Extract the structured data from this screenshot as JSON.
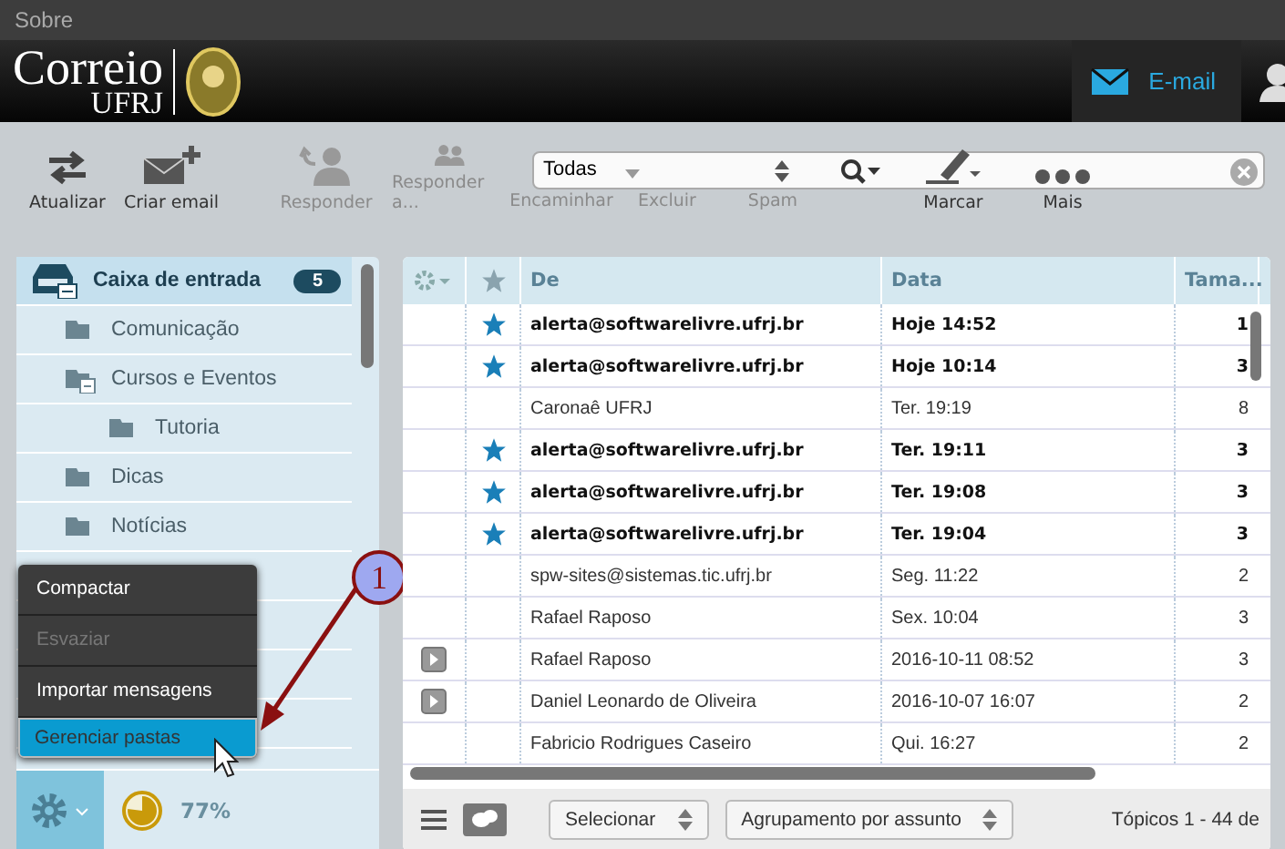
{
  "top_bar": {
    "link": "Sobre"
  },
  "header": {
    "logo_title": "Correio",
    "logo_subtitle": "UFRJ",
    "nav": [
      {
        "label": "E-mail",
        "selected": true,
        "kind": "mail"
      },
      {
        "selected": false,
        "kind": "person"
      }
    ]
  },
  "toolbar": {
    "buttons": [
      {
        "label": "Atualizar",
        "kind": "refresh",
        "disabled": false
      },
      {
        "label": "Criar email",
        "kind": "compose",
        "disabled": false
      },
      {
        "label": "Responder",
        "kind": "reply",
        "disabled": true
      },
      {
        "label": "Responder a...",
        "kind": "replyall",
        "disabled": true
      },
      {
        "label": "Encaminhar",
        "kind": "covered",
        "disabled": true
      },
      {
        "label": "Excluir",
        "kind": "covered",
        "disabled": true
      },
      {
        "label": "Spam",
        "kind": "covered",
        "disabled": true
      },
      {
        "label": "Marcar",
        "kind": "mark",
        "disabled": false
      },
      {
        "label": "Mais",
        "kind": "more",
        "disabled": false
      }
    ],
    "search": {
      "scope": "Todas"
    }
  },
  "folders": [
    {
      "name": "Caixa de entrada",
      "badge": "5",
      "expanded": true,
      "children": [
        {
          "name": "Comunicação"
        },
        {
          "name": "Cursos e Eventos",
          "expanded": true,
          "children": [
            {
              "name": "Tutoria"
            }
          ]
        },
        {
          "name": "Dicas"
        },
        {
          "name": "Notícias"
        }
      ]
    }
  ],
  "folder_menu": [
    {
      "label": "Compactar",
      "disabled": false,
      "selected": false
    },
    {
      "label": "Esvaziar",
      "disabled": true,
      "selected": false
    },
    {
      "label": "Importar mensagens",
      "disabled": false,
      "selected": false
    },
    {
      "label": "Gerenciar pastas",
      "disabled": false,
      "selected": true
    }
  ],
  "quota": {
    "level": 0.77,
    "reading": "77%"
  },
  "annotation": {
    "number": "1"
  },
  "messages": {
    "columns": [
      "De",
      "Data",
      "Tama..."
    ],
    "rows": [
      {
        "from": "alerta@softwarelivre.ufrj.br",
        "date": "Hoje 14:52",
        "size": "1",
        "flagged": true,
        "unread": true,
        "thread": false
      },
      {
        "from": "alerta@softwarelivre.ufrj.br",
        "date": "Hoje 10:14",
        "size": "3",
        "flagged": true,
        "unread": true,
        "thread": false
      },
      {
        "from": "Caronaê UFRJ",
        "date": "Ter. 19:19",
        "size": "8",
        "flagged": false,
        "unread": false,
        "thread": false
      },
      {
        "from": "alerta@softwarelivre.ufrj.br",
        "date": "Ter. 19:11",
        "size": "3",
        "flagged": true,
        "unread": true,
        "thread": false
      },
      {
        "from": "alerta@softwarelivre.ufrj.br",
        "date": "Ter. 19:08",
        "size": "3",
        "flagged": true,
        "unread": true,
        "thread": false
      },
      {
        "from": "alerta@softwarelivre.ufrj.br",
        "date": "Ter. 19:04",
        "size": "3",
        "flagged": true,
        "unread": true,
        "thread": false
      },
      {
        "from": "spw-sites@sistemas.tic.ufrj.br",
        "date": "Seg. 11:22",
        "size": "2",
        "flagged": false,
        "unread": false,
        "thread": false
      },
      {
        "from": "Rafael Raposo",
        "date": "Sex. 10:04",
        "size": "3",
        "flagged": false,
        "unread": false,
        "thread": false
      },
      {
        "from": "Rafael Raposo",
        "date": "2016-10-11 08:52",
        "size": "3",
        "flagged": false,
        "unread": false,
        "thread": true
      },
      {
        "from": "Daniel Leonardo de Oliveira",
        "date": "2016-10-07 16:07",
        "size": "2",
        "flagged": false,
        "unread": false,
        "thread": true
      },
      {
        "from": "Fabricio Rodrigues Caseiro",
        "date": "Qui. 16:27",
        "size": "2",
        "flagged": false,
        "unread": false,
        "thread": false
      }
    ]
  },
  "footer": {
    "select": "Selecionar",
    "grouping": "Agrupamento por assunto",
    "count": "Tópicos 1 - 44 de"
  }
}
